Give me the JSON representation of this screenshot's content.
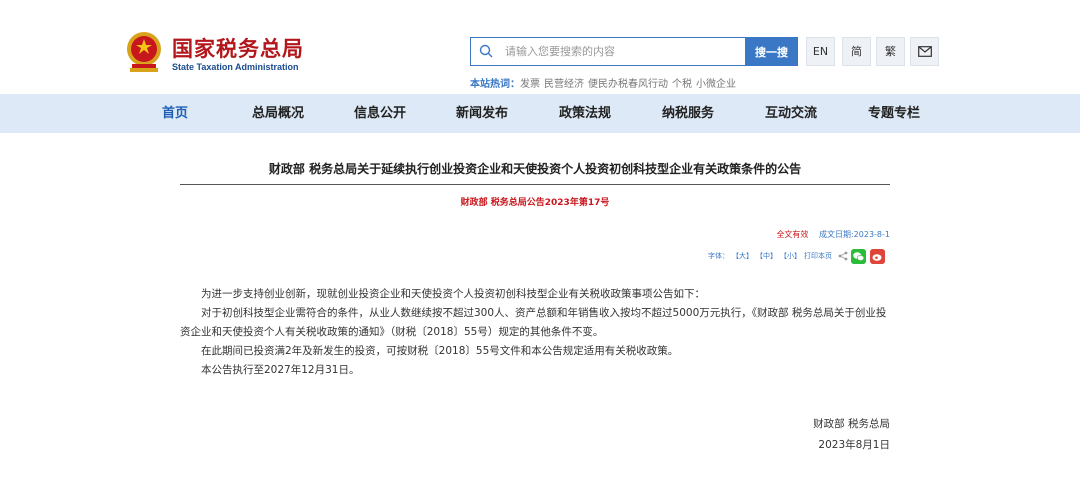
{
  "header": {
    "logo_cn": "国家税务总局",
    "logo_en": "State Taxation Administration",
    "search": {
      "placeholder": "请输入您要搜索的内容",
      "button": "搜一搜"
    },
    "hot": {
      "label": "本站热词：",
      "items": [
        "发票",
        "民营经济",
        "便民办税春风行动",
        "个税",
        "小微企业"
      ]
    },
    "tools": {
      "en": "EN",
      "simplified": "简",
      "traditional": "繁"
    }
  },
  "nav": {
    "items": [
      "首页",
      "总局概况",
      "信息公开",
      "新闻发布",
      "政策法规",
      "纳税服务",
      "互动交流",
      "专题专栏"
    ]
  },
  "article": {
    "title": "财政部 税务总局关于延续执行创业投资企业和天使投资个人投资初创科技型企业有关政策条件的公告",
    "doc_no": "财政部 税务总局公告2023年第17号",
    "validity": "全文有效",
    "date": "成文日期:2023-8-1",
    "font_tools": {
      "label": "字体：",
      "large": "【大】",
      "medium": "【中】",
      "small": "【小】",
      "print": "打印本页"
    },
    "paragraphs": [
      "为进一步支持创业创新，现就创业投资企业和天使投资个人投资初创科技型企业有关税收政策事项公告如下：",
      "对于初创科技型企业需符合的条件，从业人数继续按不超过300人、资产总额和年销售收入按均不超过5000万元执行，《财政部 税务总局关于创业投资企业和天使投资个人有关税收政策的通知》（财税〔2018〕55号）规定的其他条件不变。",
      "在此期间已投资满2年及新发生的投资，可按财税〔2018〕55号文件和本公告规定适用有关税收政策。",
      "本公告执行至2027年12月31日。"
    ],
    "signature": "财政部 税务总局",
    "sign_date": "2023年8月1日"
  }
}
